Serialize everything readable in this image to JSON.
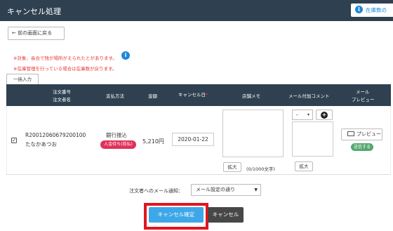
{
  "header": {
    "title": "キャンセル処理",
    "link_label": "在庫数の"
  },
  "back_button": "← 前の画面に戻る",
  "warnings": {
    "line1": "※対象、長合で残が場所がえられたとがあります。",
    "line2": "※在庫管理を行っている場合は在庫数が戻ります。"
  },
  "bulk_input_label": "一括入力",
  "table": {
    "headers": {
      "order_no": "注文番号",
      "order_name": "注文者名",
      "payment_method": "支払方法",
      "amount": "金額",
      "cancel_date": "キャンセル日",
      "required_mark": "*",
      "memo": "店舗メモ",
      "mail_comment": "メール付加コメント",
      "mail_preview_line1": "メール",
      "mail_preview_line2": "プレビュー"
    },
    "row": {
      "checked": "✓",
      "order_no": "R20012060679200100",
      "order_name": "たなかあつお",
      "payment_method": "銀行振込",
      "payment_status": "入金待ち(前払)",
      "amount": "5,210円",
      "cancel_date": "2020-01-22",
      "memo_value": "",
      "memo_expand": "拡大",
      "memo_count": "(0/1000文字)",
      "comment_select": "-",
      "comment_value": "",
      "comment_expand": "拡大",
      "preview_button": "プレビュー",
      "send_status": "送信する"
    }
  },
  "notify": {
    "label": "注文者へのメール通知：",
    "selected": "メール設定の通り"
  },
  "buttons": {
    "confirm": "キャンセル確定",
    "cancel": "キャンセル"
  },
  "colors": {
    "header_bg": "#2f4050",
    "accent_blue": "#3ea7e8",
    "warning_red": "#e53935",
    "highlight_red": "#e3141c",
    "badge_pink": "#e0315a",
    "badge_green": "#55a86e"
  }
}
